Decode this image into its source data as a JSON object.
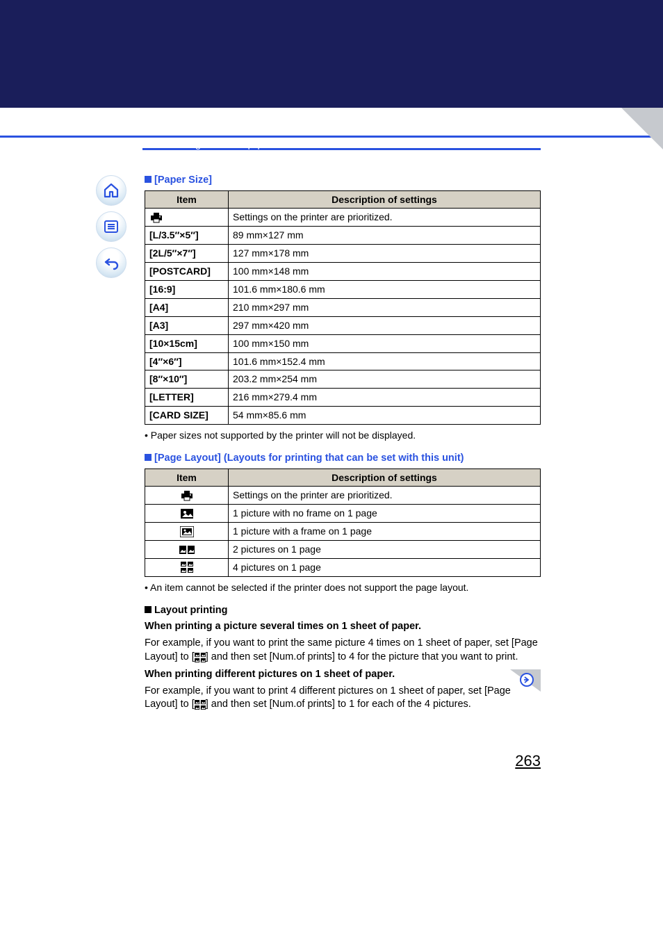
{
  "breadcrumb": "Connecting to other equipment",
  "page_number": "263",
  "paper_size": {
    "label": "[Paper Size]",
    "header_item": "Item",
    "header_desc": "Description of settings",
    "rows": [
      {
        "item_icon": "printer",
        "desc": "Settings on the printer are prioritized."
      },
      {
        "item": "[L/3.5″×5″]",
        "desc": "89 mm×127 mm"
      },
      {
        "item": "[2L/5″×7″]",
        "desc": "127 mm×178 mm"
      },
      {
        "item": "[POSTCARD]",
        "desc": "100 mm×148 mm"
      },
      {
        "item": "[16:9]",
        "desc": "101.6 mm×180.6 mm"
      },
      {
        "item": "[A4]",
        "desc": "210 mm×297 mm"
      },
      {
        "item": "[A3]",
        "desc": "297 mm×420 mm"
      },
      {
        "item": "[10×15cm]",
        "desc": "100 mm×150 mm"
      },
      {
        "item": "[4″×6″]",
        "desc": "101.6 mm×152.4 mm"
      },
      {
        "item": "[8″×10″]",
        "desc": "203.2 mm×254 mm"
      },
      {
        "item": "[LETTER]",
        "desc": "216 mm×279.4 mm"
      },
      {
        "item": "[CARD SIZE]",
        "desc": "54 mm×85.6 mm"
      }
    ],
    "note": "Paper sizes not supported by the printer will not be displayed."
  },
  "page_layout": {
    "label": "[Page Layout] (Layouts for printing that can be set with this unit)",
    "header_item": "Item",
    "header_desc": "Description of settings",
    "rows": [
      {
        "icon": "printer",
        "desc": "Settings on the printer are prioritized."
      },
      {
        "icon": "noframe",
        "desc": "1 picture with no frame on 1 page"
      },
      {
        "icon": "frame",
        "desc": "1 picture with a frame on 1 page"
      },
      {
        "icon": "two",
        "desc": "2 pictures on 1 page"
      },
      {
        "icon": "four",
        "desc": "4 pictures on 1 page"
      }
    ],
    "note": "An item cannot be selected if the printer does not support the page layout."
  },
  "layout_printing": {
    "heading": "Layout printing",
    "sub1_title": "When printing a picture several times on 1 sheet of paper.",
    "sub1_text_a": "For example, if you want to print the same picture 4 times on 1 sheet of paper, set [Page Layout] to [",
    "sub1_text_b": "] and then set [Num.of prints] to 4 for the picture that you want to print.",
    "sub2_title": "When printing different pictures on 1 sheet of paper.",
    "sub2_text_a": "For example, if you want to print 4 different pictures on 1 sheet of paper, set [Page Layout] to [",
    "sub2_text_b": "] and then set [Num.of prints] to 1 for each of the 4 pictures."
  }
}
